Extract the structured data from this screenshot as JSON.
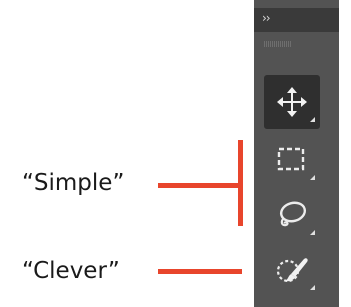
{
  "annotations": {
    "simple_label": "“Simple”",
    "clever_label": "“Clever”",
    "highlight_color": "#e8452c"
  },
  "toolbar": {
    "collapse_glyph": "››",
    "tools": [
      {
        "name": "move-tool",
        "icon": "move-icon",
        "active": true
      },
      {
        "name": "marquee-tool",
        "icon": "rectangular-marquee-icon",
        "active": false
      },
      {
        "name": "lasso-tool",
        "icon": "lasso-icon",
        "active": false
      },
      {
        "name": "quick-selection-tool",
        "icon": "quick-selection-brush-icon",
        "active": false
      }
    ]
  }
}
